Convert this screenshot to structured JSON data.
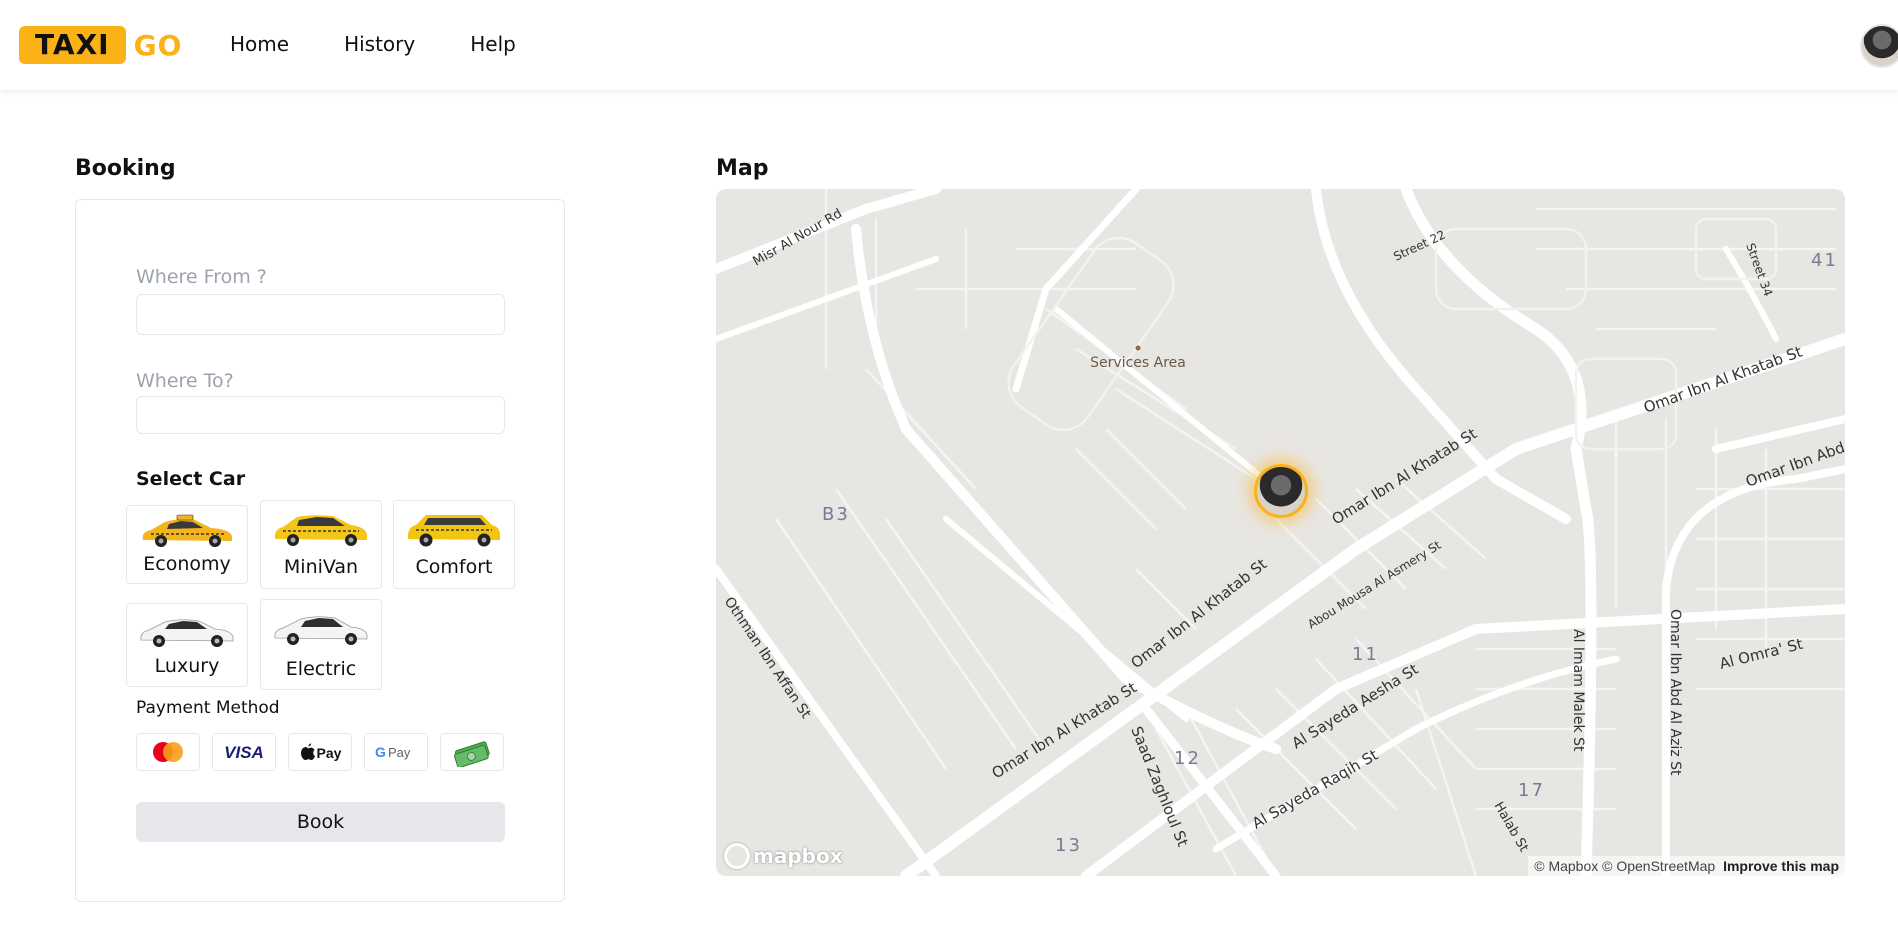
{
  "header": {
    "logo_primary": "TAXI",
    "logo_secondary": "GO",
    "nav": [
      "Home",
      "History",
      "Help"
    ]
  },
  "booking": {
    "title": "Booking",
    "from_label": "Where From ?",
    "from_value": "",
    "to_label": "Where To?",
    "to_value": "",
    "select_car_label": "Select Car",
    "cars": [
      {
        "label": "Economy",
        "color": "#f5b41a"
      },
      {
        "label": "MiniVan",
        "color": "#f5c518"
      },
      {
        "label": "Comfort",
        "color": "#f2c60f"
      },
      {
        "label": "Luxury",
        "color": "#f4f4f4"
      },
      {
        "label": "Electric",
        "color": "#f4f4f4"
      }
    ],
    "payment_title": "Payment Method",
    "payment_methods": [
      "mastercard-icon",
      "visa-icon",
      "apple-pay-icon",
      "google-pay-icon",
      "cash-icon"
    ],
    "book_label": "Book"
  },
  "map": {
    "title": "Map",
    "poi": "Services Area",
    "streets": [
      "Misr Al Nour Rd",
      "Street 22",
      "Street 34",
      "Omar Ibn Al Khatab St",
      "Omar Ibn Abd",
      "Omar Ibn Al Khatab St",
      "Abou Mousa Al Asmery St",
      "Omar Ibn Al Khatab St",
      "Othman Ibn Affan St",
      "Al Imam Malek St",
      "Omar Ibn Abd Al Aziz St",
      "Al Omra' St",
      "Omar Ibn Al Khatab St",
      "Al Sayeda Aesha St",
      "Saad Zaghloul St",
      "Al Sayeda Raqih St",
      "Halab St"
    ],
    "districts": [
      "41",
      "B3",
      "11",
      "12",
      "17",
      "13"
    ],
    "attribution_1": "© Mapbox",
    "attribution_2": "© OpenStreetMap",
    "attribution_improve": "Improve this map",
    "brand": "mapbox"
  },
  "colors": {
    "accent": "#fbb217",
    "map_bg": "#e8e6e3",
    "road": "#ffffff",
    "button_bg": "#e5e7eb"
  }
}
